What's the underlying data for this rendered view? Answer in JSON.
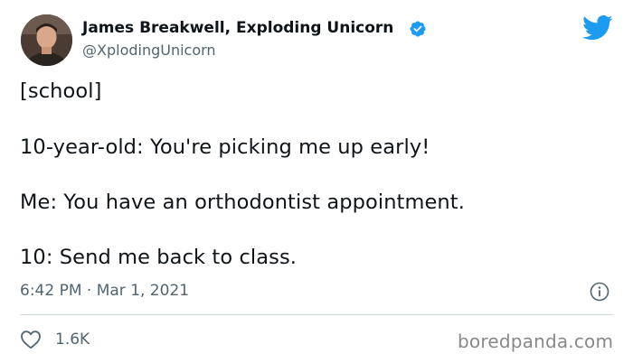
{
  "tweet": {
    "author": {
      "display_name": "James Breakwell, Exploding Unicorn",
      "handle": "@XplodingUnicorn",
      "verified": true
    },
    "body_lines": [
      "[school]",
      "10-year-old: You're picking me up early!",
      "Me: You have an orthodontist appointment.",
      "10: Send me back to class."
    ],
    "timestamp": "6:42 PM · Mar 1, 2021",
    "likes": "1.6K"
  },
  "watermark": "boredpanda.com",
  "colors": {
    "twitter_blue": "#1d9bf0",
    "text_primary": "#0f1419",
    "text_secondary": "#536471",
    "divider": "#cfd9de",
    "watermark": "#888888"
  },
  "icons": {
    "brand": "twitter-bird-icon",
    "verified": "verified-badge-icon",
    "info": "info-icon",
    "like": "heart-icon"
  }
}
